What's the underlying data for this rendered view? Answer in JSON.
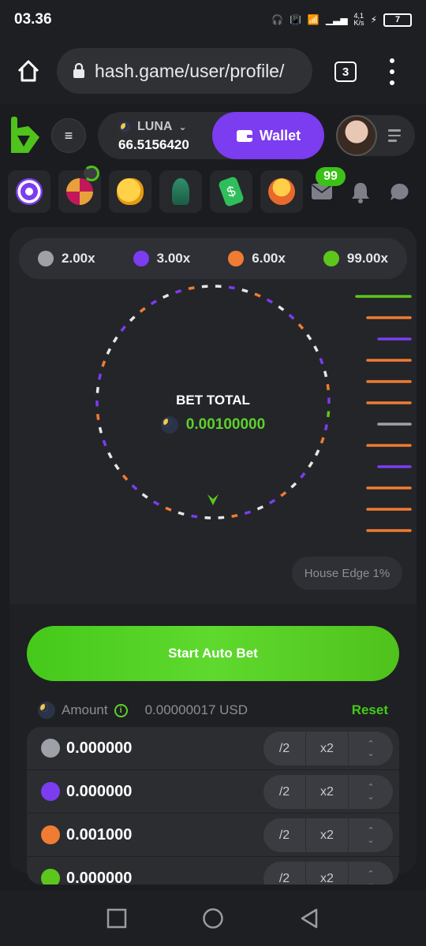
{
  "status": {
    "time": "03.36",
    "net_speed": "4,1\nK/s",
    "battery": "7",
    "volte": "Vo\nWiFi"
  },
  "browser": {
    "url": "hash.game/user/profile/",
    "tab_count": "3"
  },
  "header": {
    "currency": "LUNA",
    "balance": "66.5156420",
    "wallet_label": "Wallet"
  },
  "icons_row": {
    "messages_badge": "99",
    "tiles": [
      "dart-target-icon",
      "lucky-wheel-icon",
      "piggy-bank-icon",
      "rocket-icon",
      "cash-tag-icon",
      "coin-stack-icon"
    ]
  },
  "multipliers": [
    {
      "label": "2.00x",
      "color": "#9ea1a8"
    },
    {
      "label": "3.00x",
      "color": "#7c3cf0"
    },
    {
      "label": "6.00x",
      "color": "#f07b33"
    },
    {
      "label": "99.00x",
      "color": "#5cc61c"
    }
  ],
  "bet_total": {
    "label": "BET TOTAL",
    "value": "0.00100000"
  },
  "history_colors": [
    "#5cc61c",
    "#f07b33",
    "#7c3cf0",
    "#f07b33",
    "#f07b33",
    "#f07b33",
    "#9ea1a8",
    "#f07b33",
    "#7c3cf0",
    "#f07b33",
    "#f07b33",
    "#f07b33",
    "#7c3cf0"
  ],
  "house_edge": "House Edge 1%",
  "start_button": "Start Auto Bet",
  "amount": {
    "label": "Amount",
    "usd": "0.00000017 USD",
    "reset": "Reset"
  },
  "bet_rows": [
    {
      "color": "#9ea1a8",
      "value": "0.000000",
      "half": "/2",
      "double": "x2"
    },
    {
      "color": "#7c3cf0",
      "value": "0.000000",
      "half": "/2",
      "double": "x2"
    },
    {
      "color": "#f07b33",
      "value": "0.001000",
      "half": "/2",
      "double": "x2"
    },
    {
      "color": "#5cc61c",
      "value": "0.000000",
      "half": "/2",
      "double": "x2"
    }
  ]
}
